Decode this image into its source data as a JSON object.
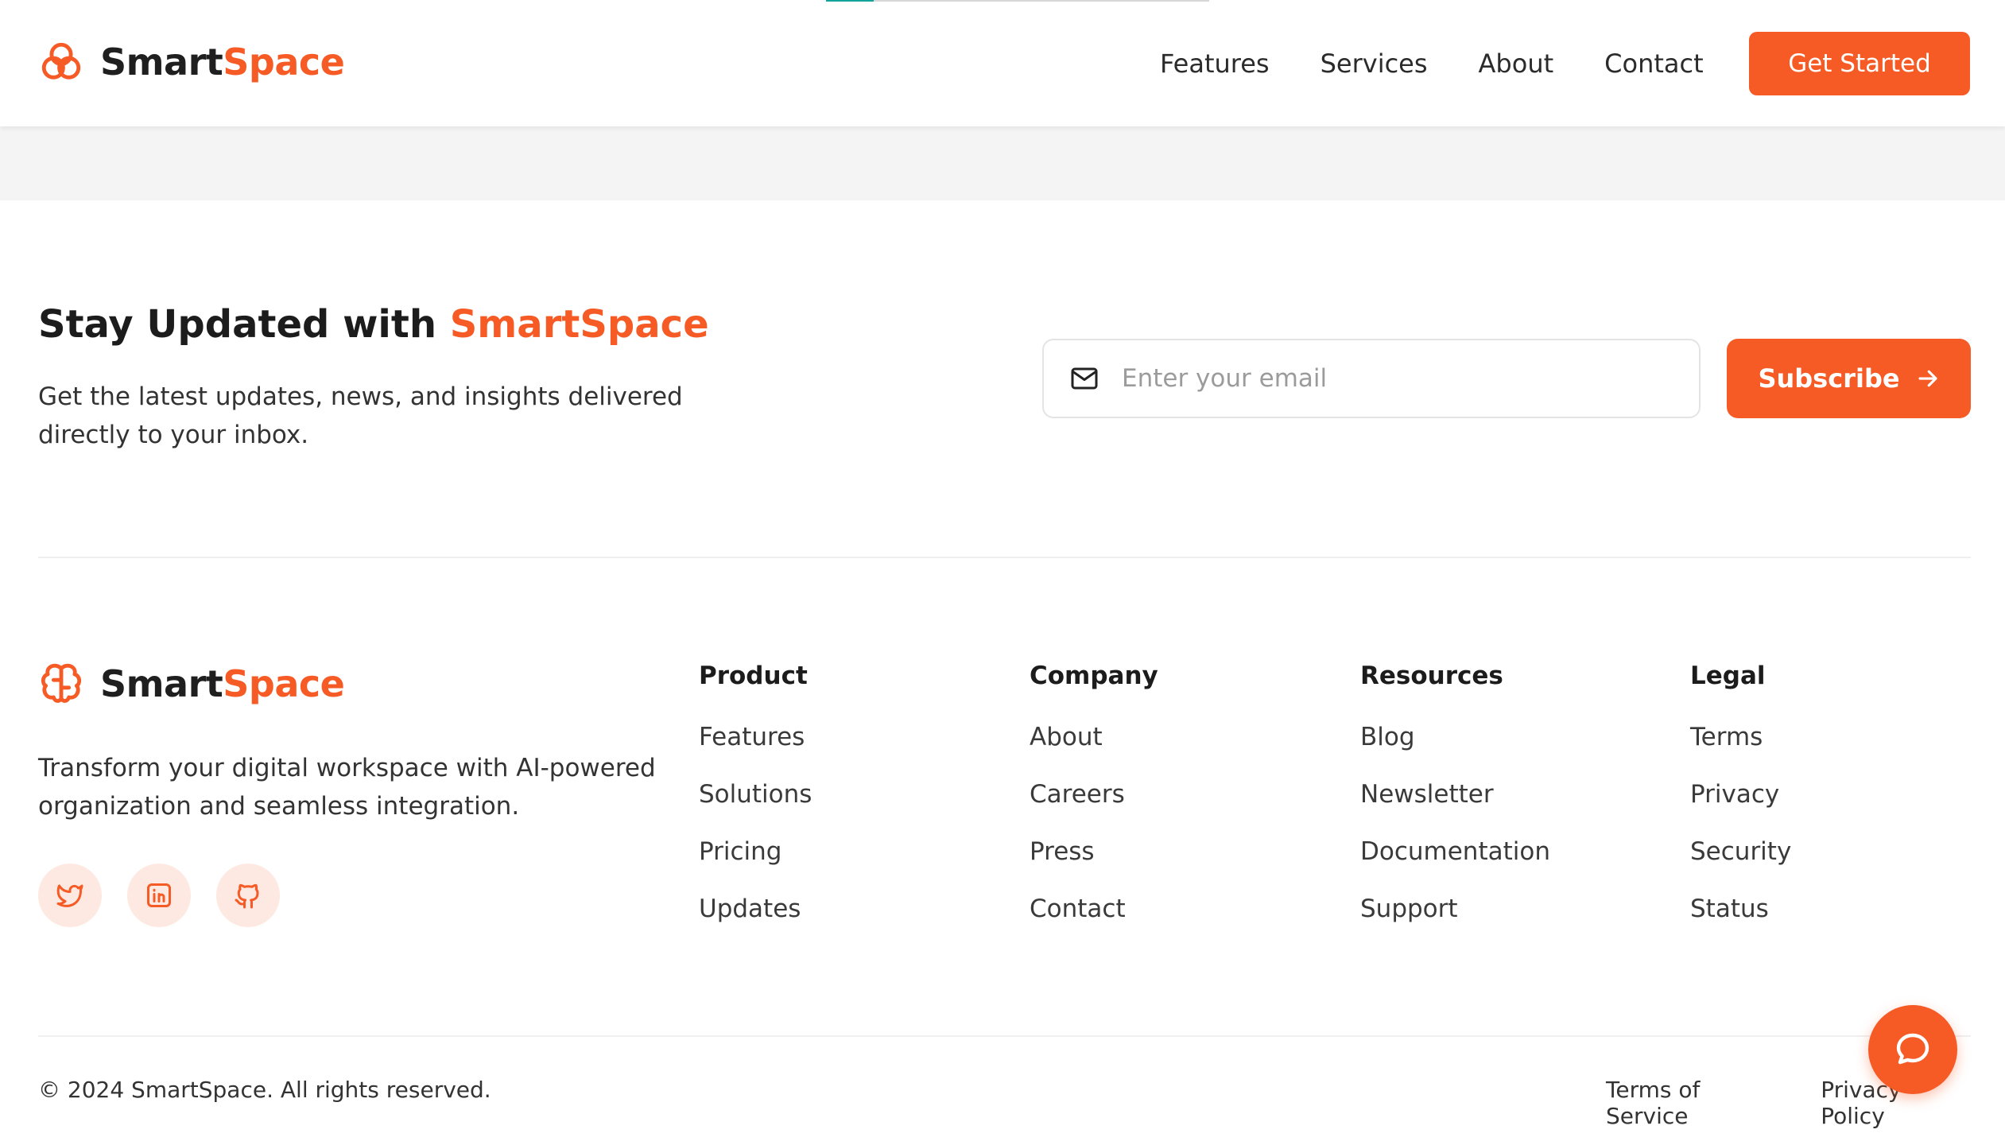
{
  "brand": {
    "name_part1": "Smart",
    "name_part2": "Space",
    "accent_color": "#f65b26",
    "progress_color": "#12a39a"
  },
  "header": {
    "scroll_progress_percent": 12.5,
    "nav": [
      "Features",
      "Services",
      "About",
      "Contact"
    ],
    "cta_label": "Get Started"
  },
  "newsletter": {
    "title_prefix": "Stay Updated with ",
    "title_accent": "SmartSpace",
    "description": "Get the latest updates, news, and insights delivered directly to your inbox.",
    "email_placeholder": "Enter your email",
    "email_icon": "mail-icon",
    "subscribe_label": "Subscribe",
    "subscribe_icon": "arrow-right-icon"
  },
  "footer": {
    "description": "Transform your digital workspace with AI-powered organization and seamless integration.",
    "socials": [
      "twitter-icon",
      "linkedin-icon",
      "github-icon"
    ],
    "columns": [
      {
        "title": "Product",
        "links": [
          "Features",
          "Solutions",
          "Pricing",
          "Updates"
        ]
      },
      {
        "title": "Company",
        "links": [
          "About",
          "Careers",
          "Press",
          "Contact"
        ]
      },
      {
        "title": "Resources",
        "links": [
          "Blog",
          "Newsletter",
          "Documentation",
          "Support"
        ]
      },
      {
        "title": "Legal",
        "links": [
          "Terms",
          "Privacy",
          "Security",
          "Status"
        ]
      }
    ],
    "copyright": "© 2024 SmartSpace. All rights reserved.",
    "bottom_links": [
      "Terms of Service",
      "Privacy Policy"
    ]
  },
  "chat": {
    "icon": "chat-bubble-icon"
  }
}
